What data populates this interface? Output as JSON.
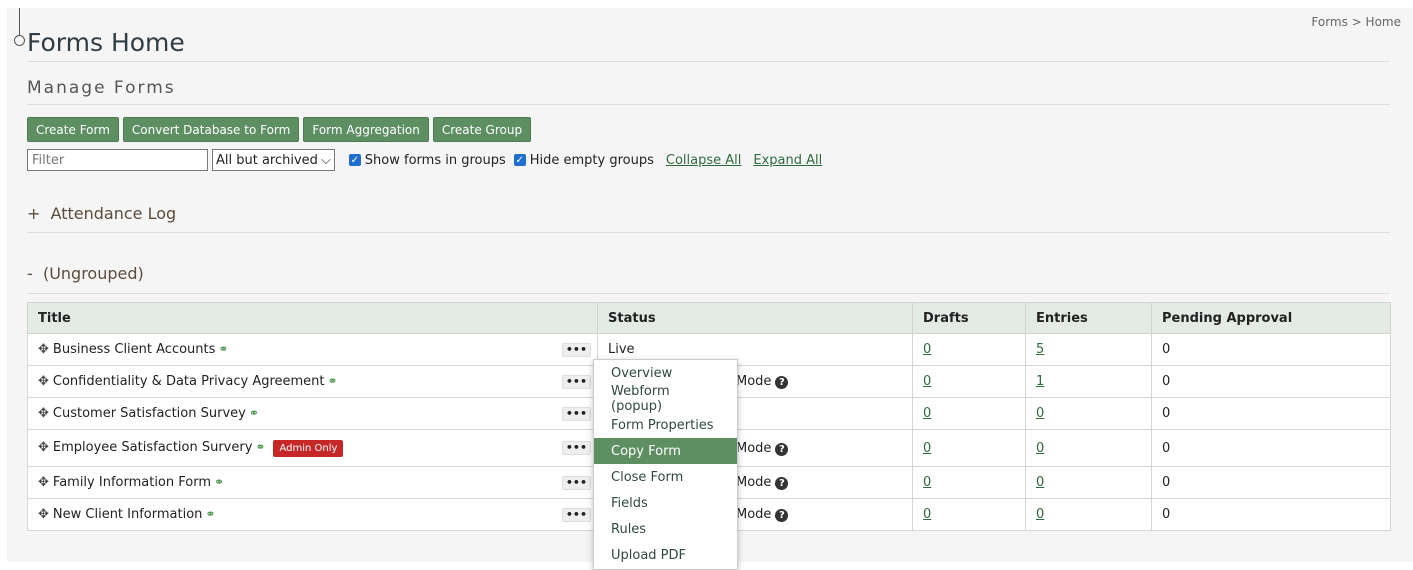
{
  "page": {
    "title": "Forms Home",
    "breadcrumb": "Forms > Home",
    "section_title": "Manage Forms"
  },
  "toolbar": {
    "buttons": [
      "Create Form",
      "Convert Database to Form",
      "Form Aggregation",
      "Create Group"
    ]
  },
  "filters": {
    "filter_placeholder": "Filter",
    "status_select": "All but archived",
    "show_in_groups_label": "Show forms in groups",
    "show_in_groups_checked": true,
    "hide_empty_label": "Hide empty groups",
    "hide_empty_checked": true,
    "collapse_all": "Collapse All",
    "expand_all": "Expand All"
  },
  "groups": [
    {
      "toggle": "+",
      "name": "Attendance Log"
    },
    {
      "toggle": "-",
      "name": "(Ungrouped)"
    }
  ],
  "table": {
    "columns": [
      "Title",
      "Status",
      "Drafts",
      "Entries",
      "Pending Approval"
    ],
    "rows": [
      {
        "title": "Business Client Accounts",
        "status": "Live",
        "drafts": "0",
        "entries": "5",
        "pending": "0"
      },
      {
        "title": "Confidentiality & Data Privacy Agreement",
        "status": "Mode",
        "drafts": "0",
        "entries": "1",
        "pending": "0"
      },
      {
        "title": "Customer Satisfaction Survey",
        "status": "",
        "drafts": "0",
        "entries": "0",
        "pending": "0"
      },
      {
        "title": "Employee Satisfaction Survery",
        "badge": "Admin Only",
        "status": "Mode",
        "drafts": "0",
        "entries": "0",
        "pending": "0"
      },
      {
        "title": "Family Information Form",
        "status": "Mode",
        "drafts": "0",
        "entries": "0",
        "pending": "0"
      },
      {
        "title": "New Client Information",
        "status": "Mode",
        "drafts": "0",
        "entries": "0",
        "pending": "0"
      }
    ]
  },
  "context_menu": {
    "items": [
      "Overview",
      "Webform (popup)",
      "Form Properties",
      "Copy Form",
      "Close Form",
      "Fields",
      "Rules",
      "Upload PDF"
    ],
    "active": "Copy Form"
  },
  "colors": {
    "button_green": "#5d8f63",
    "badge_red": "#c62828",
    "link_green": "#2e6b3c"
  }
}
